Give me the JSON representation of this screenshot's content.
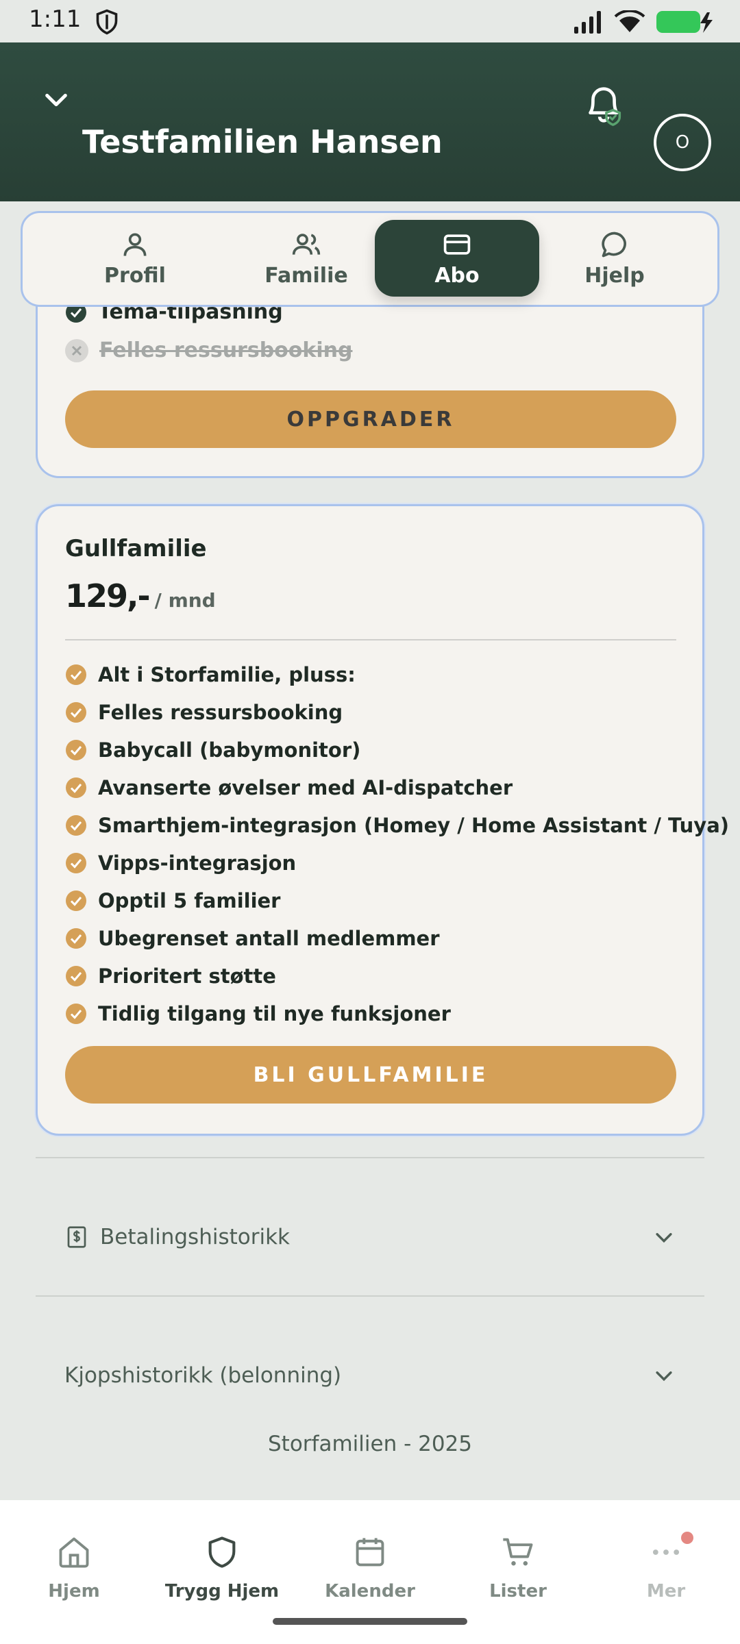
{
  "status": {
    "time": "1:11"
  },
  "header": {
    "title": "Testfamilien Hansen",
    "avatar_initial": "O"
  },
  "tabs": [
    {
      "label": "Profil",
      "icon": "person-icon",
      "active": false
    },
    {
      "label": "Familie",
      "icon": "people-icon",
      "active": false
    },
    {
      "label": "Abo",
      "icon": "card-icon",
      "active": true
    },
    {
      "label": "Hjelp",
      "icon": "chat-bubble-icon",
      "active": false
    }
  ],
  "previous_plan": {
    "cut_feature": "Tema-tilpasning",
    "disabled_feature": "Felles ressursbooking",
    "button": "OPPGRADER"
  },
  "gold_plan": {
    "name": "Gullfamilie",
    "price": "129,-",
    "per": "/ mnd",
    "features": [
      "Alt i Storfamilie, pluss:",
      "Felles ressursbooking",
      "Babycall (babymonitor)",
      "Avanserte øvelser med AI-dispatcher",
      "Smarthjem-integrasjon (Homey / Home Assistant / Tuya)",
      "Vipps-integrasjon",
      "Opptil 5 familier",
      "Ubegrenset antall medlemmer",
      "Prioritert støtte",
      "Tidlig tilgang til nye funksjoner"
    ],
    "button": "BLI GULLFAMILIE"
  },
  "accordions": {
    "payment_history": "Betalingshistorikk",
    "purchase_history": "Kjopshistorikk (belonning)"
  },
  "footer": "Storfamilien - 2025",
  "bottom_nav": [
    {
      "label": "Hjem",
      "icon": "home-icon"
    },
    {
      "label": "Trygg Hjem",
      "icon": "shield-icon"
    },
    {
      "label": "Kalender",
      "icon": "calendar-icon"
    },
    {
      "label": "Lister",
      "icon": "cart-icon"
    },
    {
      "label": "Mer",
      "icon": "more-dots-icon"
    }
  ],
  "colors": {
    "header": "#2c4439",
    "accent_gold": "#d5a057",
    "active_tab": "#2c4439",
    "border_blue": "#a9c2ec"
  }
}
